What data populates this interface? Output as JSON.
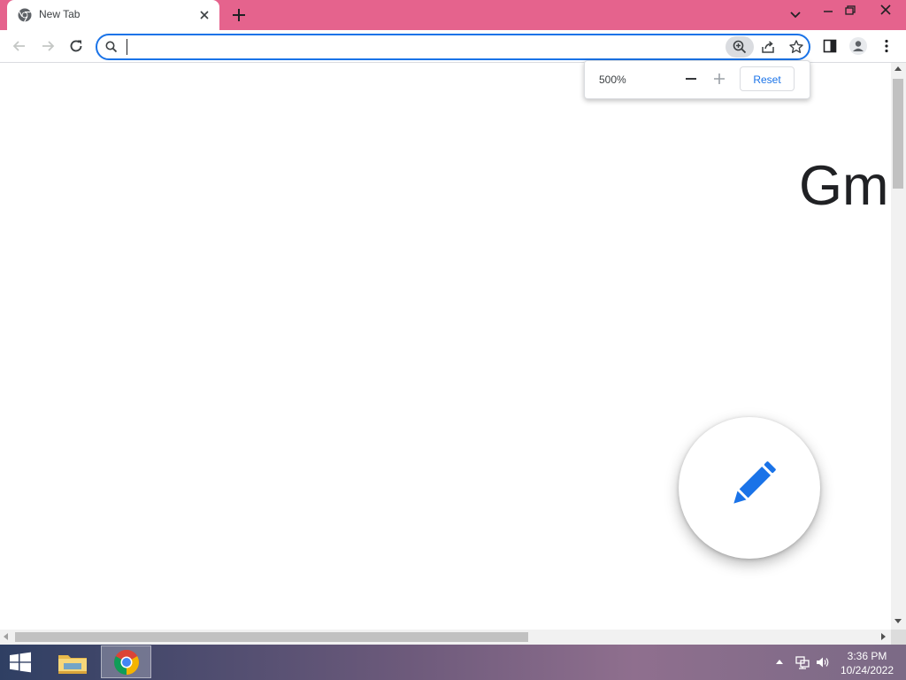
{
  "browser": {
    "tab": {
      "title": "New Tab"
    },
    "omnibox": {
      "value": ""
    },
    "zoom_bubble": {
      "level": "500%",
      "reset_label": "Reset"
    }
  },
  "page": {
    "gmail_text": "Gm"
  },
  "taskbar": {
    "time": "3:36 PM",
    "date": "10/24/2022"
  },
  "colors": {
    "tabstrip": "#e5638d",
    "accent": "#1a73e8",
    "fab_icon": "#1a73e8"
  },
  "icons": {
    "tab_favicon": "chrome-icon",
    "omnibox_left": "search-icon",
    "zoom": "zoom-in-icon",
    "share": "share-icon",
    "bookmark": "star-icon",
    "side_panel": "side-panel-icon",
    "profile": "profile-icon",
    "menu": "kebab-menu-icon",
    "fab": "pencil-icon"
  }
}
